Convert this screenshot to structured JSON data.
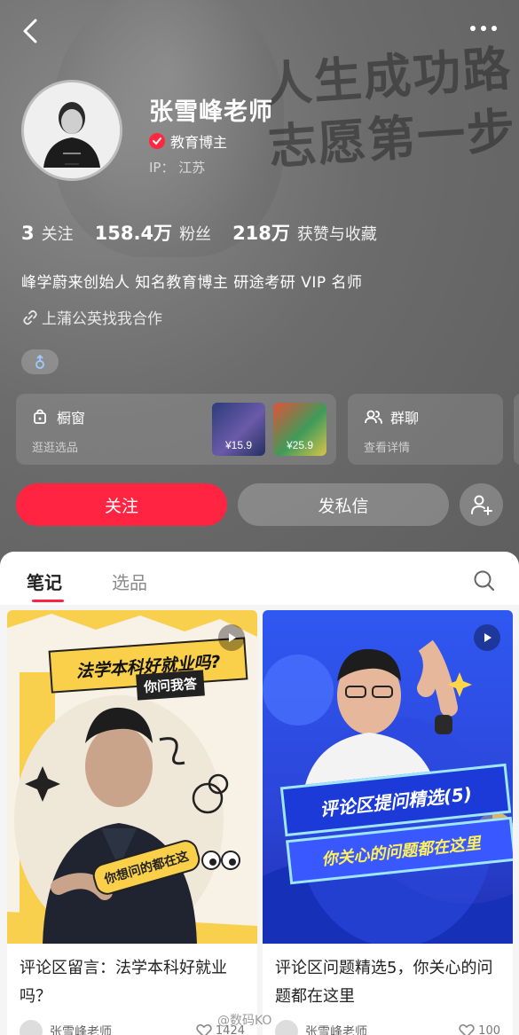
{
  "profile": {
    "name": "张雪峰老师",
    "verification": "教育博主",
    "ip_label": "IP：",
    "ip_location": "江苏",
    "background_slogan": "人生成功路\n志愿第一步",
    "bio": "峰学蔚来创始人 知名教育博主 研途考研 VIP 名师",
    "link_text": "上蒲公英找我合作",
    "gender": "male"
  },
  "stats": [
    {
      "value": "3",
      "label": "关注"
    },
    {
      "value": "158.4万",
      "label": "粉丝"
    },
    {
      "value": "218万",
      "label": "获赞与收藏"
    }
  ],
  "shop_card": {
    "title": "橱窗",
    "subtitle": "逛逛选品",
    "items": [
      {
        "price": "¥15.9"
      },
      {
        "price": "¥25.9"
      }
    ]
  },
  "group_card": {
    "title": "群聊",
    "subtitle": "查看详情"
  },
  "actions": {
    "follow": "关注",
    "message": "发私信"
  },
  "tabs": [
    {
      "label": "笔记",
      "active": true
    },
    {
      "label": "选品",
      "active": false
    }
  ],
  "notes": [
    {
      "title": "评论区留言：法学本科好就业吗？",
      "cover_headline": "法学本科好就业吗?",
      "cover_sub": "你问我答",
      "cover_bubble": "你想问的都在这",
      "author": "张雪峰老师",
      "likes": "1424"
    },
    {
      "title": "评论区问题精选5，你关心的问题都在这里",
      "cover_headline": "评论区提问精选(5)",
      "cover_sub": "你关心的问题都在这里",
      "author": "张雪峰老师",
      "likes": "100"
    }
  ],
  "watermark": "@数码KO",
  "colors": {
    "accent": "#ff2442",
    "header_bg": "#6c6c6c",
    "verify_badge": "#ff2742"
  }
}
